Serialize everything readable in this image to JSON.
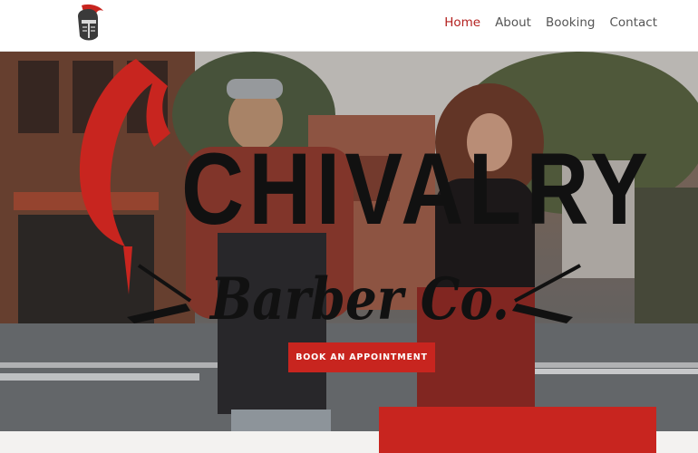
{
  "nav": {
    "items": [
      {
        "label": "Home",
        "active": true
      },
      {
        "label": "About",
        "active": false
      },
      {
        "label": "Booking",
        "active": false
      },
      {
        "label": "Contact",
        "active": false
      }
    ]
  },
  "hero": {
    "brand_main": "CHIVALRY",
    "brand_sub": "Barber Co.",
    "cta_label": "BOOK AN APPOINTMENT"
  },
  "colors": {
    "accent": "#c8251f",
    "nav_active": "#b3211f",
    "nav_text": "#555555",
    "brand_text": "#111111"
  },
  "icons": {
    "site_logo": "knight-helmet-icon",
    "razor_left": "straight-razor-icon",
    "razor_right": "straight-razor-icon"
  }
}
